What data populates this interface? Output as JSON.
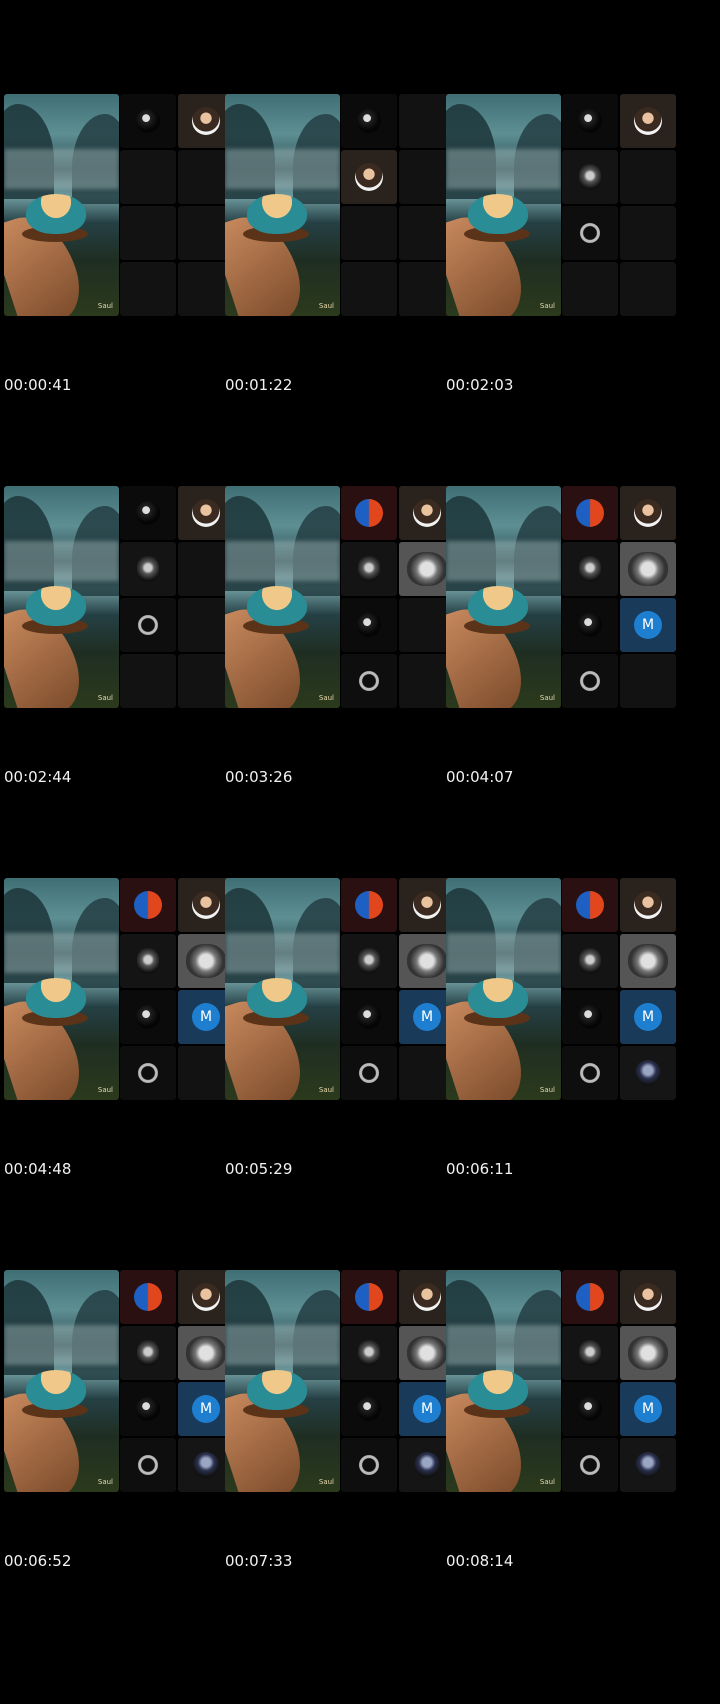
{
  "frames": [
    {
      "time": "00:00:41",
      "tiles": [
        "mask",
        "person",
        "empty",
        "empty",
        "empty",
        "empty",
        "empty",
        "empty"
      ]
    },
    {
      "time": "00:01:22",
      "tiles": [
        "mask",
        "empty",
        "person",
        "empty",
        "empty",
        "empty",
        "empty",
        "empty"
      ]
    },
    {
      "time": "00:02:03",
      "tiles": [
        "mask",
        "person",
        "robot",
        "empty",
        "ring",
        "empty",
        "empty",
        "empty"
      ]
    },
    {
      "time": "00:02:44",
      "tiles": [
        "mask",
        "person",
        "robot",
        "empty",
        "ring",
        "empty",
        "empty",
        "empty"
      ]
    },
    {
      "time": "00:03:26",
      "tiles": [
        "fire",
        "person",
        "robot",
        "sketch",
        "mask",
        "empty",
        "ring",
        "empty"
      ]
    },
    {
      "time": "00:04:07",
      "tiles": [
        "fire",
        "person",
        "robot",
        "sketch",
        "mask",
        "m",
        "ring",
        "empty"
      ]
    },
    {
      "time": "00:04:48",
      "tiles": [
        "fire",
        "person",
        "robot",
        "sketch",
        "mask",
        "m",
        "ring",
        "empty"
      ]
    },
    {
      "time": "00:05:29",
      "tiles": [
        "fire",
        "person",
        "robot",
        "sketch",
        "mask",
        "m",
        "ring",
        "empty"
      ]
    },
    {
      "time": "00:06:11",
      "tiles": [
        "fire",
        "person",
        "robot",
        "sketch",
        "mask",
        "m",
        "ring",
        "char"
      ]
    },
    {
      "time": "00:06:52",
      "tiles": [
        "fire",
        "person",
        "robot",
        "sketch",
        "mask",
        "m",
        "ring",
        "char"
      ]
    },
    {
      "time": "00:07:33",
      "tiles": [
        "fire",
        "person",
        "robot",
        "sketch",
        "mask",
        "m",
        "ring",
        "char"
      ]
    },
    {
      "time": "00:08:14",
      "tiles": [
        "fire",
        "person",
        "robot",
        "sketch",
        "mask",
        "m",
        "ring",
        "char"
      ]
    }
  ],
  "avatar_letter": "M",
  "hero_signature": "Saul",
  "colors": {
    "background": "#000000",
    "tile_empty": "#121212",
    "m_avatar": "#1e7fd1",
    "timestamp": "#f2f2f2"
  }
}
